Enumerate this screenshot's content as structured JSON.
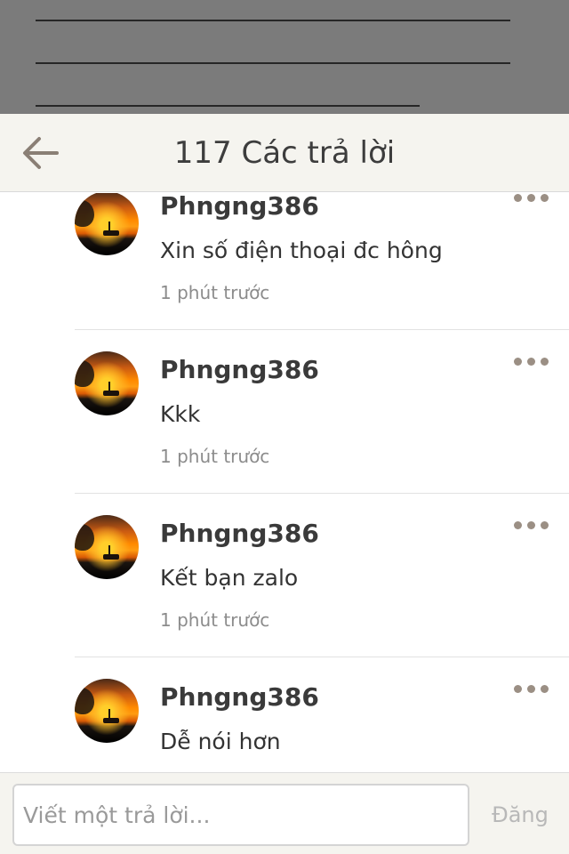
{
  "header": {
    "title": "117 Các trả lời",
    "back_icon": "arrow-left-icon"
  },
  "comments": [
    {
      "username": "Phngng386",
      "text": "Xin số điện thoại đc hông",
      "time": "1 phút trước"
    },
    {
      "username": "Phngng386",
      "text": "Kkk",
      "time": "1 phút trước"
    },
    {
      "username": "Phngng386",
      "text": "Kết bạn zalo",
      "time": "1 phút trước"
    },
    {
      "username": "Phngng386",
      "text": "Dễ nói hơn",
      "time": ""
    }
  ],
  "footer": {
    "placeholder": "Viết một trả lời...",
    "post_label": "Đăng"
  },
  "colors": {
    "overlay": "#7b7b7b",
    "header_bg": "#f5f4ef",
    "more_dots": "#9b8f84"
  }
}
